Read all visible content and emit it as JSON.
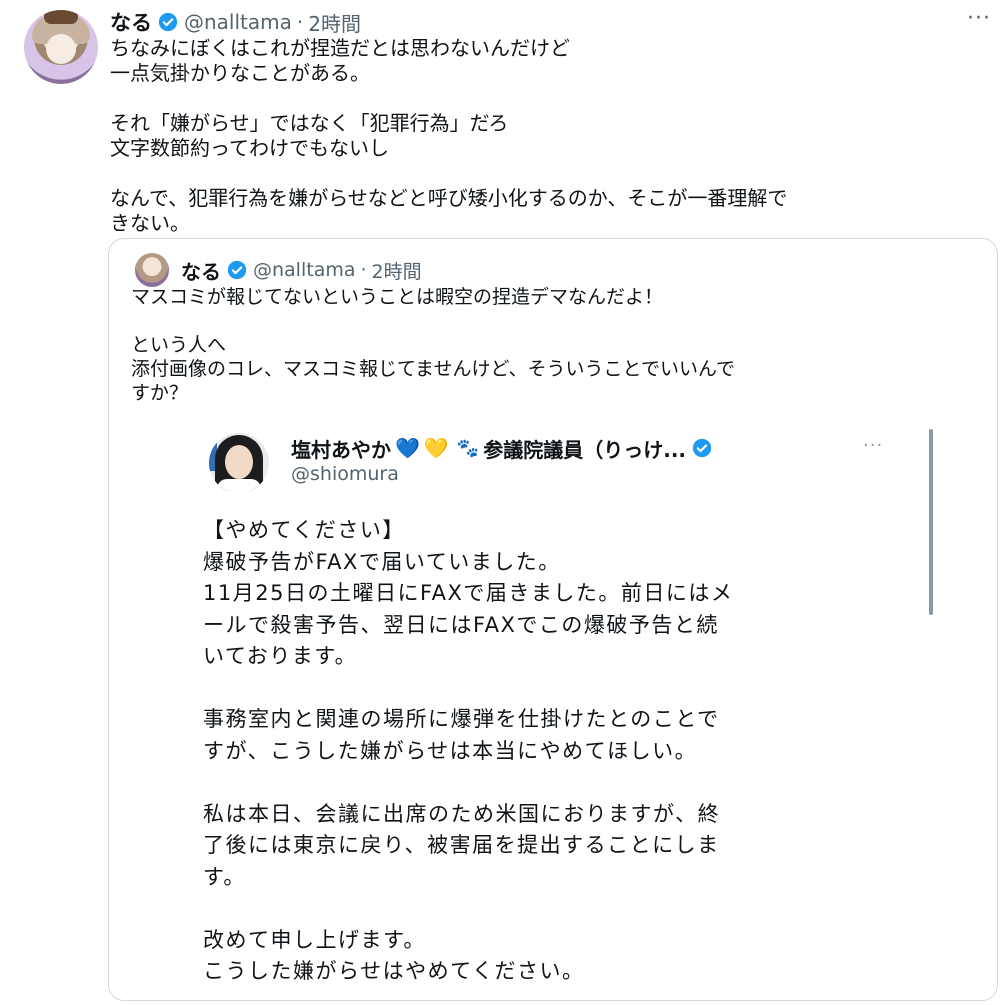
{
  "tweet": {
    "author": "なる",
    "handle": "@nalltama",
    "separator": "·",
    "time": "2時間",
    "more": "···",
    "text": "ちなみにぼくはこれが捏造だとは思わないんだけど\n一点気掛かりなことがある。\n\nそれ「嫌がらせ」ではなく「犯罪行為」だろ\n文字数節約ってわけでもないし\n\nなんで、犯罪行為を嫌がらせなどと呼び矮小化するのか、そこが一番理解で\nきない。"
  },
  "quote": {
    "author": "なる",
    "handle": "@nalltama",
    "separator": "·",
    "time": "2時間",
    "text": "マスコミが報じてないということは暇空の捏造デマなんだよ！\n\nという人へ\n添付画像のコレ、マスコミ報じてませんけど、そういうことでいいんで\nすか？"
  },
  "image_card": {
    "name": "塩村あやか",
    "hearts": [
      "💙",
      "💛"
    ],
    "paw": "🐾",
    "title": "参議院議員（りっけ...",
    "more": "···",
    "handle": "@shiomura",
    "body": "【やめてください】\n爆破予告がFAXで届いていました。\n11月25日の土曜日にFAXで届きました。前日にはメ\nールで殺害予告、翌日にはFAXでこの爆破予告と続\nいております。\n\n事務室内と関連の場所に爆弾を仕掛けたとのことで\nすが、こうした嫌がらせは本当にやめてほしい。\n\n私は本日、会議に出席のため米国におりますが、終\n了後には東京に戻り、被害届を提出することにしま\nす。\n\n改めて申し上げます。\nこうした嫌がらせはやめてください。"
  },
  "colors": {
    "verified": "#1d9bf0",
    "secondary_text": "#536471",
    "border": "#cfd9de"
  }
}
